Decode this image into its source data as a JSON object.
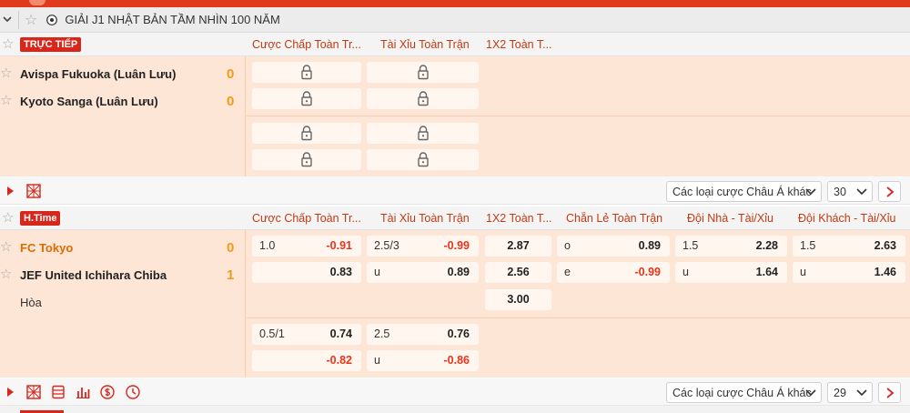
{
  "league": {
    "title": "GIẢI J1 NHẬT BẢN TẦM NHÌN 100 NĂM"
  },
  "match1": {
    "badge": "TRỰC TIẾP",
    "columns": [
      "Cược Chấp Toàn Tr...",
      "Tài Xỉu Toàn Trận",
      "1X2 Toàn T..."
    ],
    "home": {
      "name": "Avispa Fukuoka (Luân Lưu)",
      "score": "0"
    },
    "away": {
      "name": "Kyoto Sanga (Luân Lưu)",
      "score": "0"
    },
    "locked_cells": 8,
    "footer": {
      "market_select": "Các loại cược Châu Á khác",
      "count": "30"
    }
  },
  "match2": {
    "badge": "H.Time",
    "columns": [
      "Cược Chấp Toàn Tr...",
      "Tài Xỉu Toàn Trận",
      "1X2 Toàn T...",
      "Chẵn Lẻ Toàn Trận",
      "Đội Nhà - Tài/Xỉu",
      "Đội Khách - Tài/Xỉu"
    ],
    "home": {
      "name": "FC Tokyo",
      "score": "0"
    },
    "away": {
      "name": "JEF United Ichihara Chiba",
      "score": "1"
    },
    "draw": "Hòa",
    "main": {
      "handicap": [
        {
          "line": "1.0",
          "odds": "-0.91"
        },
        {
          "line": "",
          "odds": "0.83"
        }
      ],
      "overunder": [
        {
          "line": "2.5/3",
          "odds": "-0.99"
        },
        {
          "line": "u",
          "odds": "0.89"
        }
      ],
      "x12": [
        "2.87",
        "2.56",
        "3.00"
      ],
      "oddeven": [
        {
          "line": "o",
          "odds": "0.89"
        },
        {
          "line": "e",
          "odds": "-0.99"
        }
      ],
      "home_ou": [
        {
          "line": "1.5",
          "odds": "2.28"
        },
        {
          "line": "u",
          "odds": "1.64"
        }
      ],
      "away_ou": [
        {
          "line": "1.5",
          "odds": "2.63"
        },
        {
          "line": "u",
          "odds": "1.46"
        }
      ]
    },
    "alt": {
      "handicap": [
        {
          "line": "0.5/1",
          "odds": "0.74"
        },
        {
          "line": "",
          "odds": "-0.82"
        }
      ],
      "overunder": [
        {
          "line": "2.5",
          "odds": "0.76"
        },
        {
          "line": "u",
          "odds": "-0.86"
        }
      ]
    },
    "footer": {
      "market_select": "Các loại cược Châu Á khác",
      "count": "29"
    }
  },
  "icons": [
    "chevron-down-icon",
    "star-icon",
    "soccer-ball-icon",
    "lock-icon",
    "play-icon",
    "field-icon",
    "list-icon",
    "stats-icon",
    "currency-icon",
    "clock-icon",
    "chevron-right-icon"
  ],
  "colors": {
    "accent": "#d8261a",
    "odds_negative": "#e8351c",
    "score": "#f59a18",
    "row_bg": "#fde6d6",
    "header_text": "#c23a12"
  }
}
